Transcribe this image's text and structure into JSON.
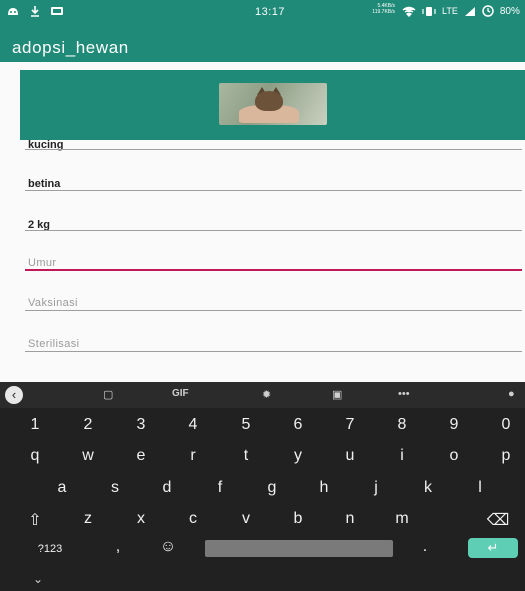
{
  "status_bar": {
    "time": "13:17",
    "net_speed_up": "5.4KB/s",
    "net_speed_down": "119.7KB/s",
    "network": "LTE",
    "battery": "80%",
    "icons": [
      "android-icon",
      "download-icon",
      "cast-icon",
      "wifi-icon",
      "vibrate-icon",
      "signal-icon",
      "battery-icon"
    ]
  },
  "appbar": {
    "title": "adopsi_hewan"
  },
  "colors": {
    "primary": "#1f8a77",
    "accent": "#c2185b",
    "enter_key": "#5ecfb5"
  },
  "form": {
    "fields": [
      {
        "value": "kucing",
        "placeholder": ""
      },
      {
        "value": "betina",
        "placeholder": ""
      },
      {
        "value": "2 kg",
        "placeholder": ""
      },
      {
        "value": "",
        "placeholder": "Umur"
      },
      {
        "value": "",
        "placeholder": "Vaksinasi"
      },
      {
        "value": "",
        "placeholder": "Sterilisasi"
      }
    ]
  },
  "keyboard": {
    "toolbar": {
      "gif": "GIF",
      "more": "•••"
    },
    "numbers": [
      "1",
      "2",
      "3",
      "4",
      "5",
      "6",
      "7",
      "8",
      "9",
      "0"
    ],
    "row1": [
      "q",
      "w",
      "e",
      "r",
      "t",
      "y",
      "u",
      "i",
      "o",
      "p"
    ],
    "row2": [
      "a",
      "s",
      "d",
      "f",
      "g",
      "h",
      "j",
      "k",
      "l"
    ],
    "row3": [
      "z",
      "x",
      "c",
      "v",
      "b",
      "n",
      "m"
    ],
    "symbols_key": "?123",
    "comma": ",",
    "period": "."
  }
}
